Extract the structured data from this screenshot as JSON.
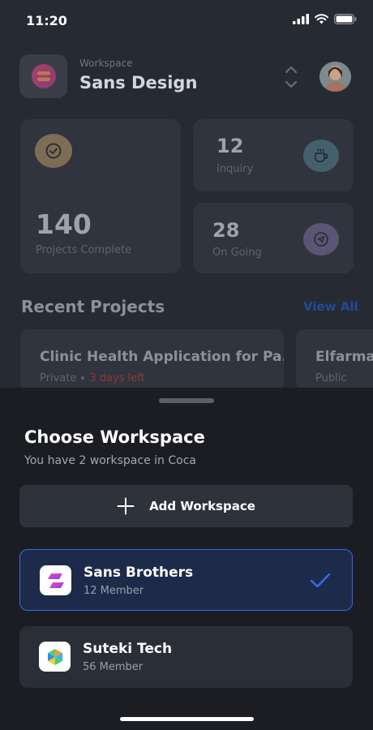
{
  "status_bar": {
    "time": "11:20"
  },
  "header": {
    "caption": "Workspace",
    "workspace_name": "Sans Design"
  },
  "stats": {
    "projects_complete": {
      "value": "140",
      "label": "Projects Complete"
    },
    "inquiry": {
      "value": "12",
      "label": "Inquiry"
    },
    "on_going": {
      "value": "28",
      "label": "On Going"
    }
  },
  "recent": {
    "title": "Recent Projects",
    "view_all": "View All",
    "projects": [
      {
        "title": "Clinic Health Application for Pa...",
        "visibility": "Private",
        "deadline": "3 days left"
      },
      {
        "title": "Elfarma",
        "visibility": "Public",
        "deadline": ""
      }
    ]
  },
  "sheet": {
    "title": "Choose Workspace",
    "subtitle": "You have 2 workspace in Coca",
    "add_label": "Add Workspace",
    "workspaces": [
      {
        "name": "Sans Brothers",
        "members": "12 Member",
        "selected": true
      },
      {
        "name": "Suteki Tech",
        "members": "56 Member",
        "selected": false
      }
    ]
  },
  "colors": {
    "accent": "#2f6ef0",
    "sheet_bg": "#1b1d23",
    "overlay_bg": "#262a33",
    "danger": "#8a3a3a"
  },
  "icons": [
    "cellular-icon",
    "wifi-icon",
    "battery-icon",
    "chevron-up-down-icon",
    "check-circle-icon",
    "cup-icon",
    "send-icon",
    "plus-icon",
    "check-icon"
  ]
}
